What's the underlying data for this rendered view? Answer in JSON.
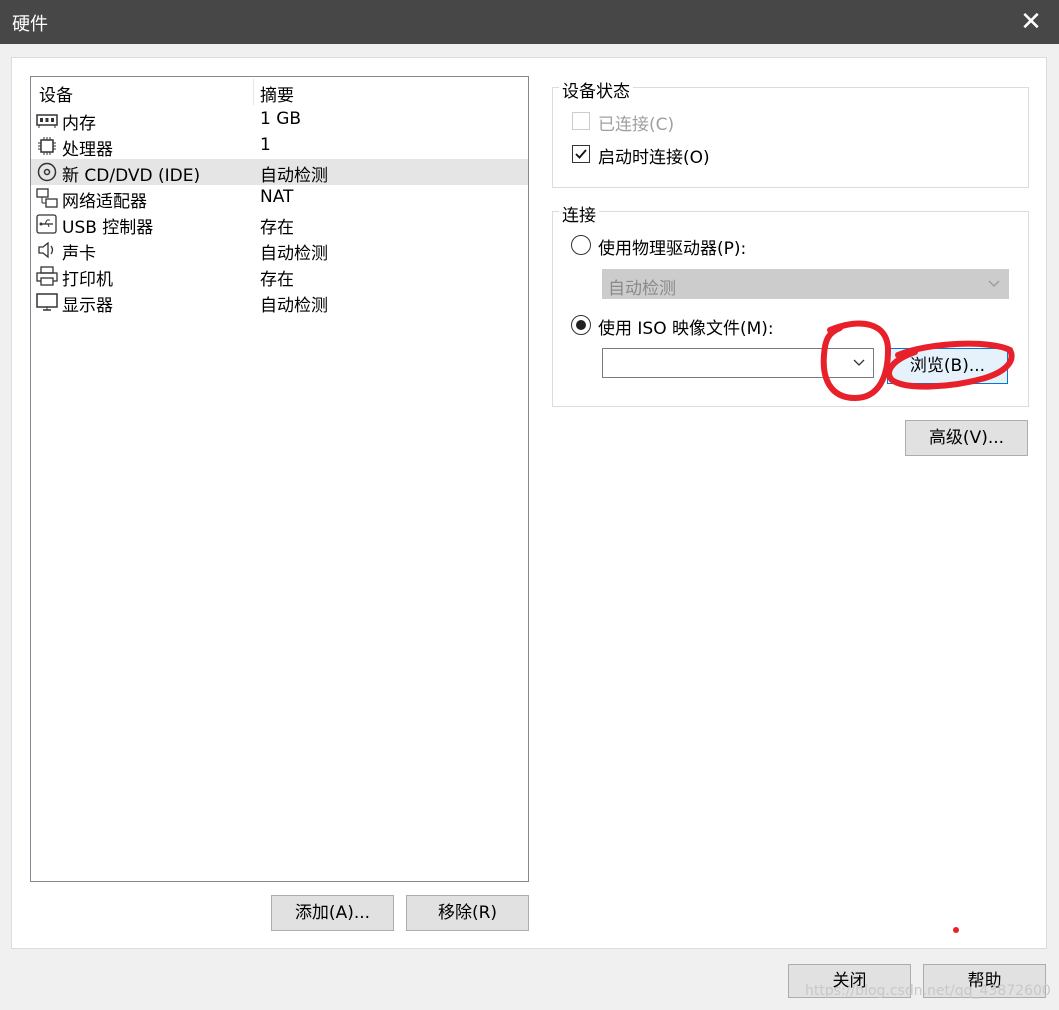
{
  "window": {
    "title": "硬件",
    "close_glyph": "✕"
  },
  "device_list": {
    "headers": {
      "device": "设备",
      "summary": "摘要"
    },
    "rows": [
      {
        "name": "内存",
        "summary": "1 GB",
        "icon": "memory-icon"
      },
      {
        "name": "处理器",
        "summary": "1",
        "icon": "processor-icon"
      },
      {
        "name": "新 CD/DVD (IDE)",
        "summary": "自动检测",
        "icon": "cd-dvd-icon",
        "selected": true
      },
      {
        "name": "网络适配器",
        "summary": "NAT",
        "icon": "network-icon"
      },
      {
        "name": "USB 控制器",
        "summary": "存在",
        "icon": "usb-icon"
      },
      {
        "name": "声卡",
        "summary": "自动检测",
        "icon": "speaker-icon"
      },
      {
        "name": "打印机",
        "summary": "存在",
        "icon": "printer-icon"
      },
      {
        "name": "显示器",
        "summary": "自动检测",
        "icon": "monitor-icon"
      }
    ]
  },
  "list_buttons": {
    "add": "添加(A)...",
    "remove": "移除(R)"
  },
  "device_status": {
    "title": "设备状态",
    "connected": {
      "label": "已连接(C)",
      "checked": false,
      "disabled": true
    },
    "connect_at_power_on": {
      "label": "启动时连接(O)",
      "checked": true
    }
  },
  "connection": {
    "title": "连接",
    "physical": {
      "label": "使用物理驱动器(P):",
      "selected": false,
      "value": "自动检测"
    },
    "iso": {
      "label": "使用 ISO 映像文件(M):",
      "selected": true,
      "value": ""
    },
    "browse_label": "浏览(B)..."
  },
  "advanced_label": "高级(V)...",
  "footer": {
    "close": "关闭",
    "help": "帮助"
  },
  "watermark": "https://blog.csdn.net/qq_43872600",
  "annotation_color": "#e8202a"
}
